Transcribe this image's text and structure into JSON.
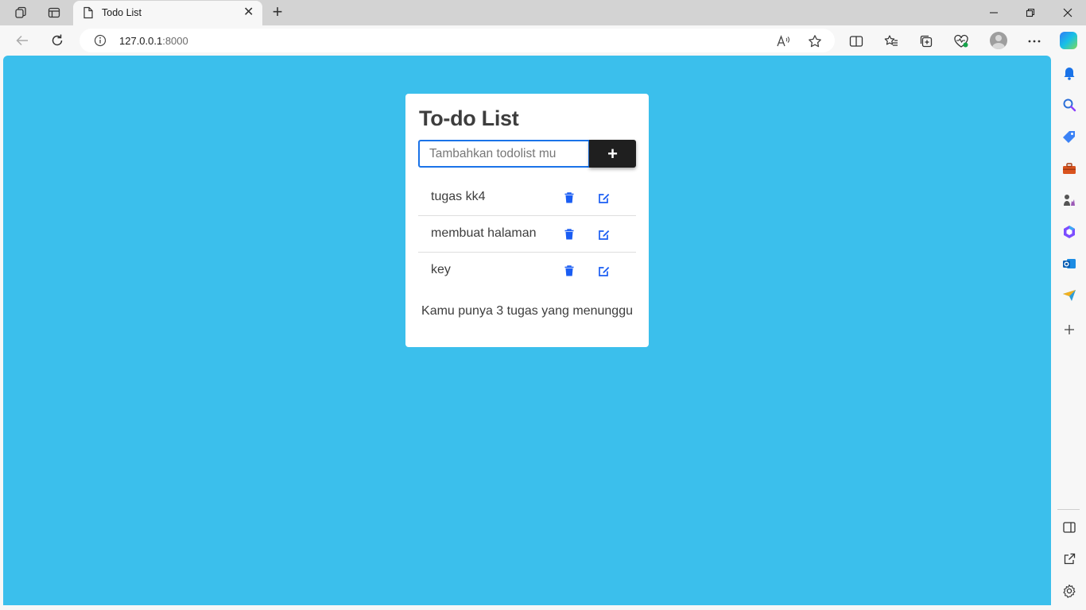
{
  "browser": {
    "tab_title": "Todo List",
    "url_host": "127.0.0.1",
    "url_port": ":8000",
    "icons": {
      "workspaces": "workspaces-icon",
      "tab_actions": "tab-actions-icon",
      "document": "document-icon",
      "close": "close-icon",
      "new_tab": "plus-icon",
      "back": "back-arrow-icon",
      "refresh": "refresh-icon",
      "info": "info-icon",
      "read_aloud": "read-aloud-icon",
      "favorite": "star-icon",
      "split_screen": "split-screen-icon",
      "favorites": "favorites-icon",
      "collections": "collections-icon",
      "health": "browser-essentials-icon",
      "more": "more-icon",
      "copilot": "copilot-icon"
    }
  },
  "app": {
    "title": "To-do List",
    "input_placeholder": "Tambahkan todolist mu",
    "add_label": "+",
    "items": [
      {
        "text": "tugas kk4"
      },
      {
        "text": "membuat halaman"
      },
      {
        "text": "key"
      }
    ],
    "footer": "Kamu punya 3 tugas yang menunggu"
  },
  "colors": {
    "page_background": "#3bbfec",
    "accent_blue": "#1a5df3",
    "button_dark": "#1f1f1f"
  },
  "sidebar": {
    "icons": [
      "bell-icon",
      "search-icon",
      "tag-icon",
      "toolbox-icon",
      "chess-icon",
      "office-icon",
      "outlook-icon",
      "send-icon",
      "add-icon",
      "sidebar-toggle-icon",
      "external-link-icon",
      "settings-icon"
    ]
  }
}
